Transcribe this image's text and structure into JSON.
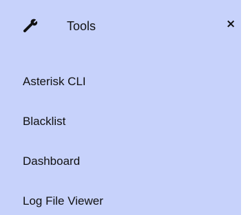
{
  "panel": {
    "title": "Tools",
    "title_icon": "wrench-icon",
    "close_icon": "close-icon",
    "close_glyph": "×",
    "background_color": "#c7d2fb",
    "items": [
      {
        "label": "Asterisk CLI"
      },
      {
        "label": "Blacklist"
      },
      {
        "label": "Dashboard"
      },
      {
        "label": "Log File Viewer"
      }
    ]
  }
}
